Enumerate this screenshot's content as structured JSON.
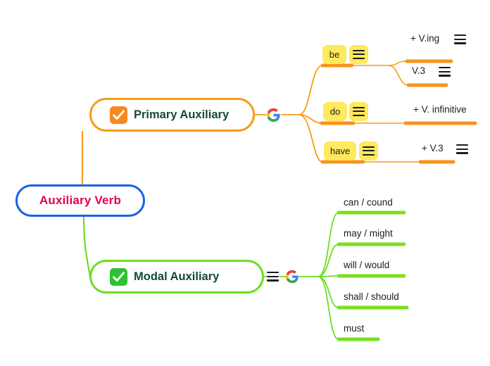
{
  "diagram": {
    "type": "mind-map",
    "title": "Auxiliary Verb"
  },
  "root": {
    "label": "Auxiliary Verb",
    "border_color": "#1a62e8",
    "text_color": "#e4004f"
  },
  "branches": [
    {
      "id": "primary",
      "label": "Primary Auxiliary",
      "accent_color": "#f99b16",
      "checkbox_color": "#f6891f",
      "checkbox_icon": "checkbox-checked-icon",
      "trailing_icons": [
        "google-g-icon"
      ],
      "children": [
        {
          "label": "be",
          "style": "chip",
          "menu_icon": "hamburger-menu-icon",
          "children": [
            {
              "label": "+ V.ing",
              "menu_icon": "hamburger-menu-icon"
            },
            {
              "label": "V.3",
              "menu_icon": "hamburger-menu-icon"
            }
          ]
        },
        {
          "label": "do",
          "style": "chip",
          "menu_icon": "hamburger-menu-icon",
          "children": [
            {
              "label": "+ V. infinitive",
              "menu_icon": null
            }
          ]
        },
        {
          "label": "have",
          "style": "chip",
          "menu_icon": "hamburger-menu-icon",
          "children": [
            {
              "label": "+ V.3",
              "menu_icon": "hamburger-menu-icon"
            }
          ]
        }
      ]
    },
    {
      "id": "modal",
      "label": "Modal Auxiliary",
      "accent_color": "#6ddd24",
      "checkbox_color": "#2fc12f",
      "checkbox_icon": "checkbox-checked-icon",
      "trailing_icons": [
        "hamburger-menu-icon",
        "google-g-icon"
      ],
      "children": [
        {
          "label": "can / cound",
          "menu_icon": null
        },
        {
          "label": "may / might",
          "menu_icon": null
        },
        {
          "label": "will / would",
          "menu_icon": null
        },
        {
          "label": "shall / should",
          "menu_icon": null
        },
        {
          "label": "must",
          "menu_icon": null
        }
      ]
    }
  ],
  "colors": {
    "orange_line": "#f99b16",
    "orange_underline": "#f7931e",
    "green_line": "#6ddd24",
    "green_underline": "#7ae01f",
    "chip_bg": "#ffe95c",
    "root_border": "#1a62e8",
    "root_text": "#e4004f",
    "branch_text": "#144b34"
  }
}
